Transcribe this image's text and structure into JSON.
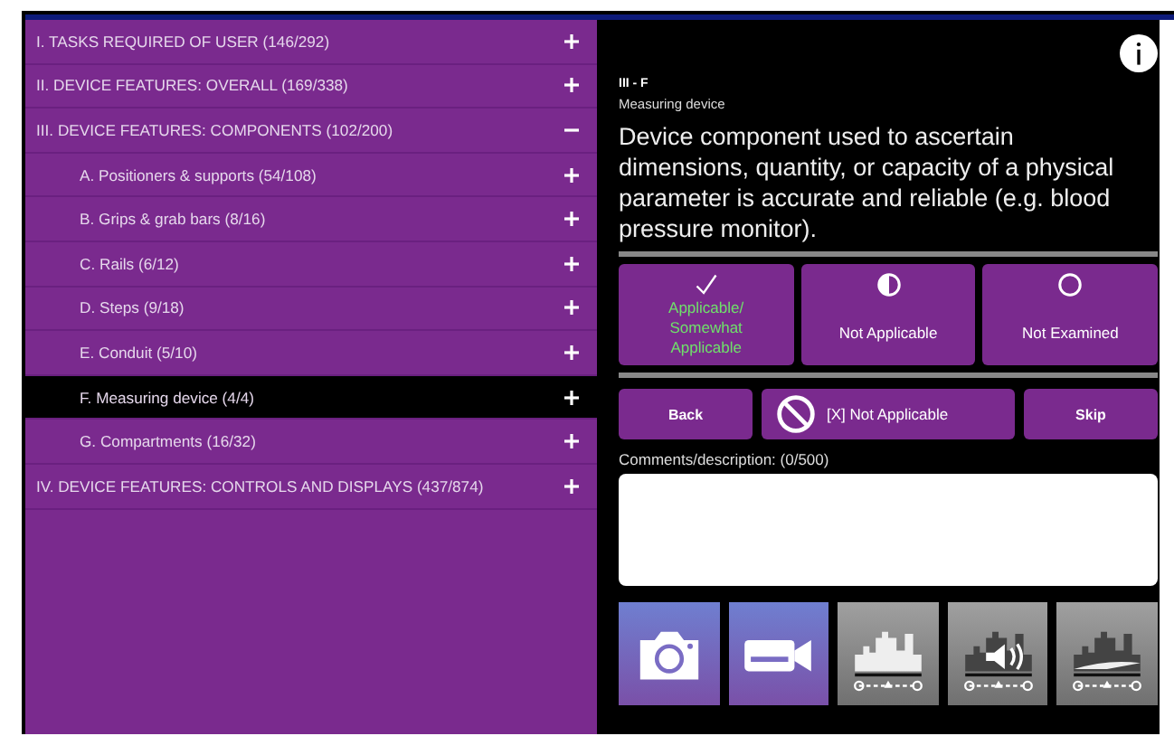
{
  "sections": [
    {
      "label": "I. TASKS REQUIRED OF USER (146/292)",
      "expanded": false,
      "selected": false
    },
    {
      "label": "II. DEVICE FEATURES: OVERALL (169/338)",
      "expanded": false,
      "selected": false
    },
    {
      "label": "III. DEVICE FEATURES: COMPONENTS (102/200)",
      "expanded": true,
      "selected": false,
      "children": [
        {
          "label": "A.  Positioners & supports (54/108)",
          "expanded": false,
          "selected": false
        },
        {
          "label": "B.  Grips & grab bars (8/16)",
          "expanded": false,
          "selected": false
        },
        {
          "label": "C.  Rails (6/12)",
          "expanded": false,
          "selected": false
        },
        {
          "label": "D.  Steps (9/18)",
          "expanded": false,
          "selected": false
        },
        {
          "label": "E.  Conduit (5/10)",
          "expanded": false,
          "selected": false
        },
        {
          "label": "F.  Measuring device (4/4)",
          "expanded": false,
          "selected": true
        },
        {
          "label": "G.  Compartments (16/32)",
          "expanded": false,
          "selected": false
        }
      ]
    },
    {
      "label": "IV. DEVICE FEATURES: CONTROLS AND DISPLAYS (437/874)",
      "expanded": false,
      "selected": false
    }
  ],
  "detail": {
    "code": "III - F",
    "name": "Measuring device",
    "description": "Device component used to ascertain dimensions, quantity, or capacity of a physical parameter is accurate and reliable (e.g. blood pressure monitor)."
  },
  "ratings": [
    {
      "kind": "check",
      "label": "Applicable/ Somewhat Applicable",
      "selected": true
    },
    {
      "kind": "half",
      "label": "Not Applicable",
      "selected": false
    },
    {
      "kind": "ring",
      "label": "Not Examined",
      "selected": false
    }
  ],
  "actions": [
    {
      "kind": "back",
      "label": "Back"
    },
    {
      "kind": "na",
      "label": "[X] Not Applicable"
    },
    {
      "kind": "skip",
      "label": "Skip"
    }
  ],
  "comments": {
    "label": "Comments/description: (0/500)"
  },
  "media": [
    {
      "kind": "camera"
    },
    {
      "kind": "video"
    },
    {
      "kind": "scene"
    },
    {
      "kind": "sound"
    },
    {
      "kind": "motion"
    }
  ]
}
